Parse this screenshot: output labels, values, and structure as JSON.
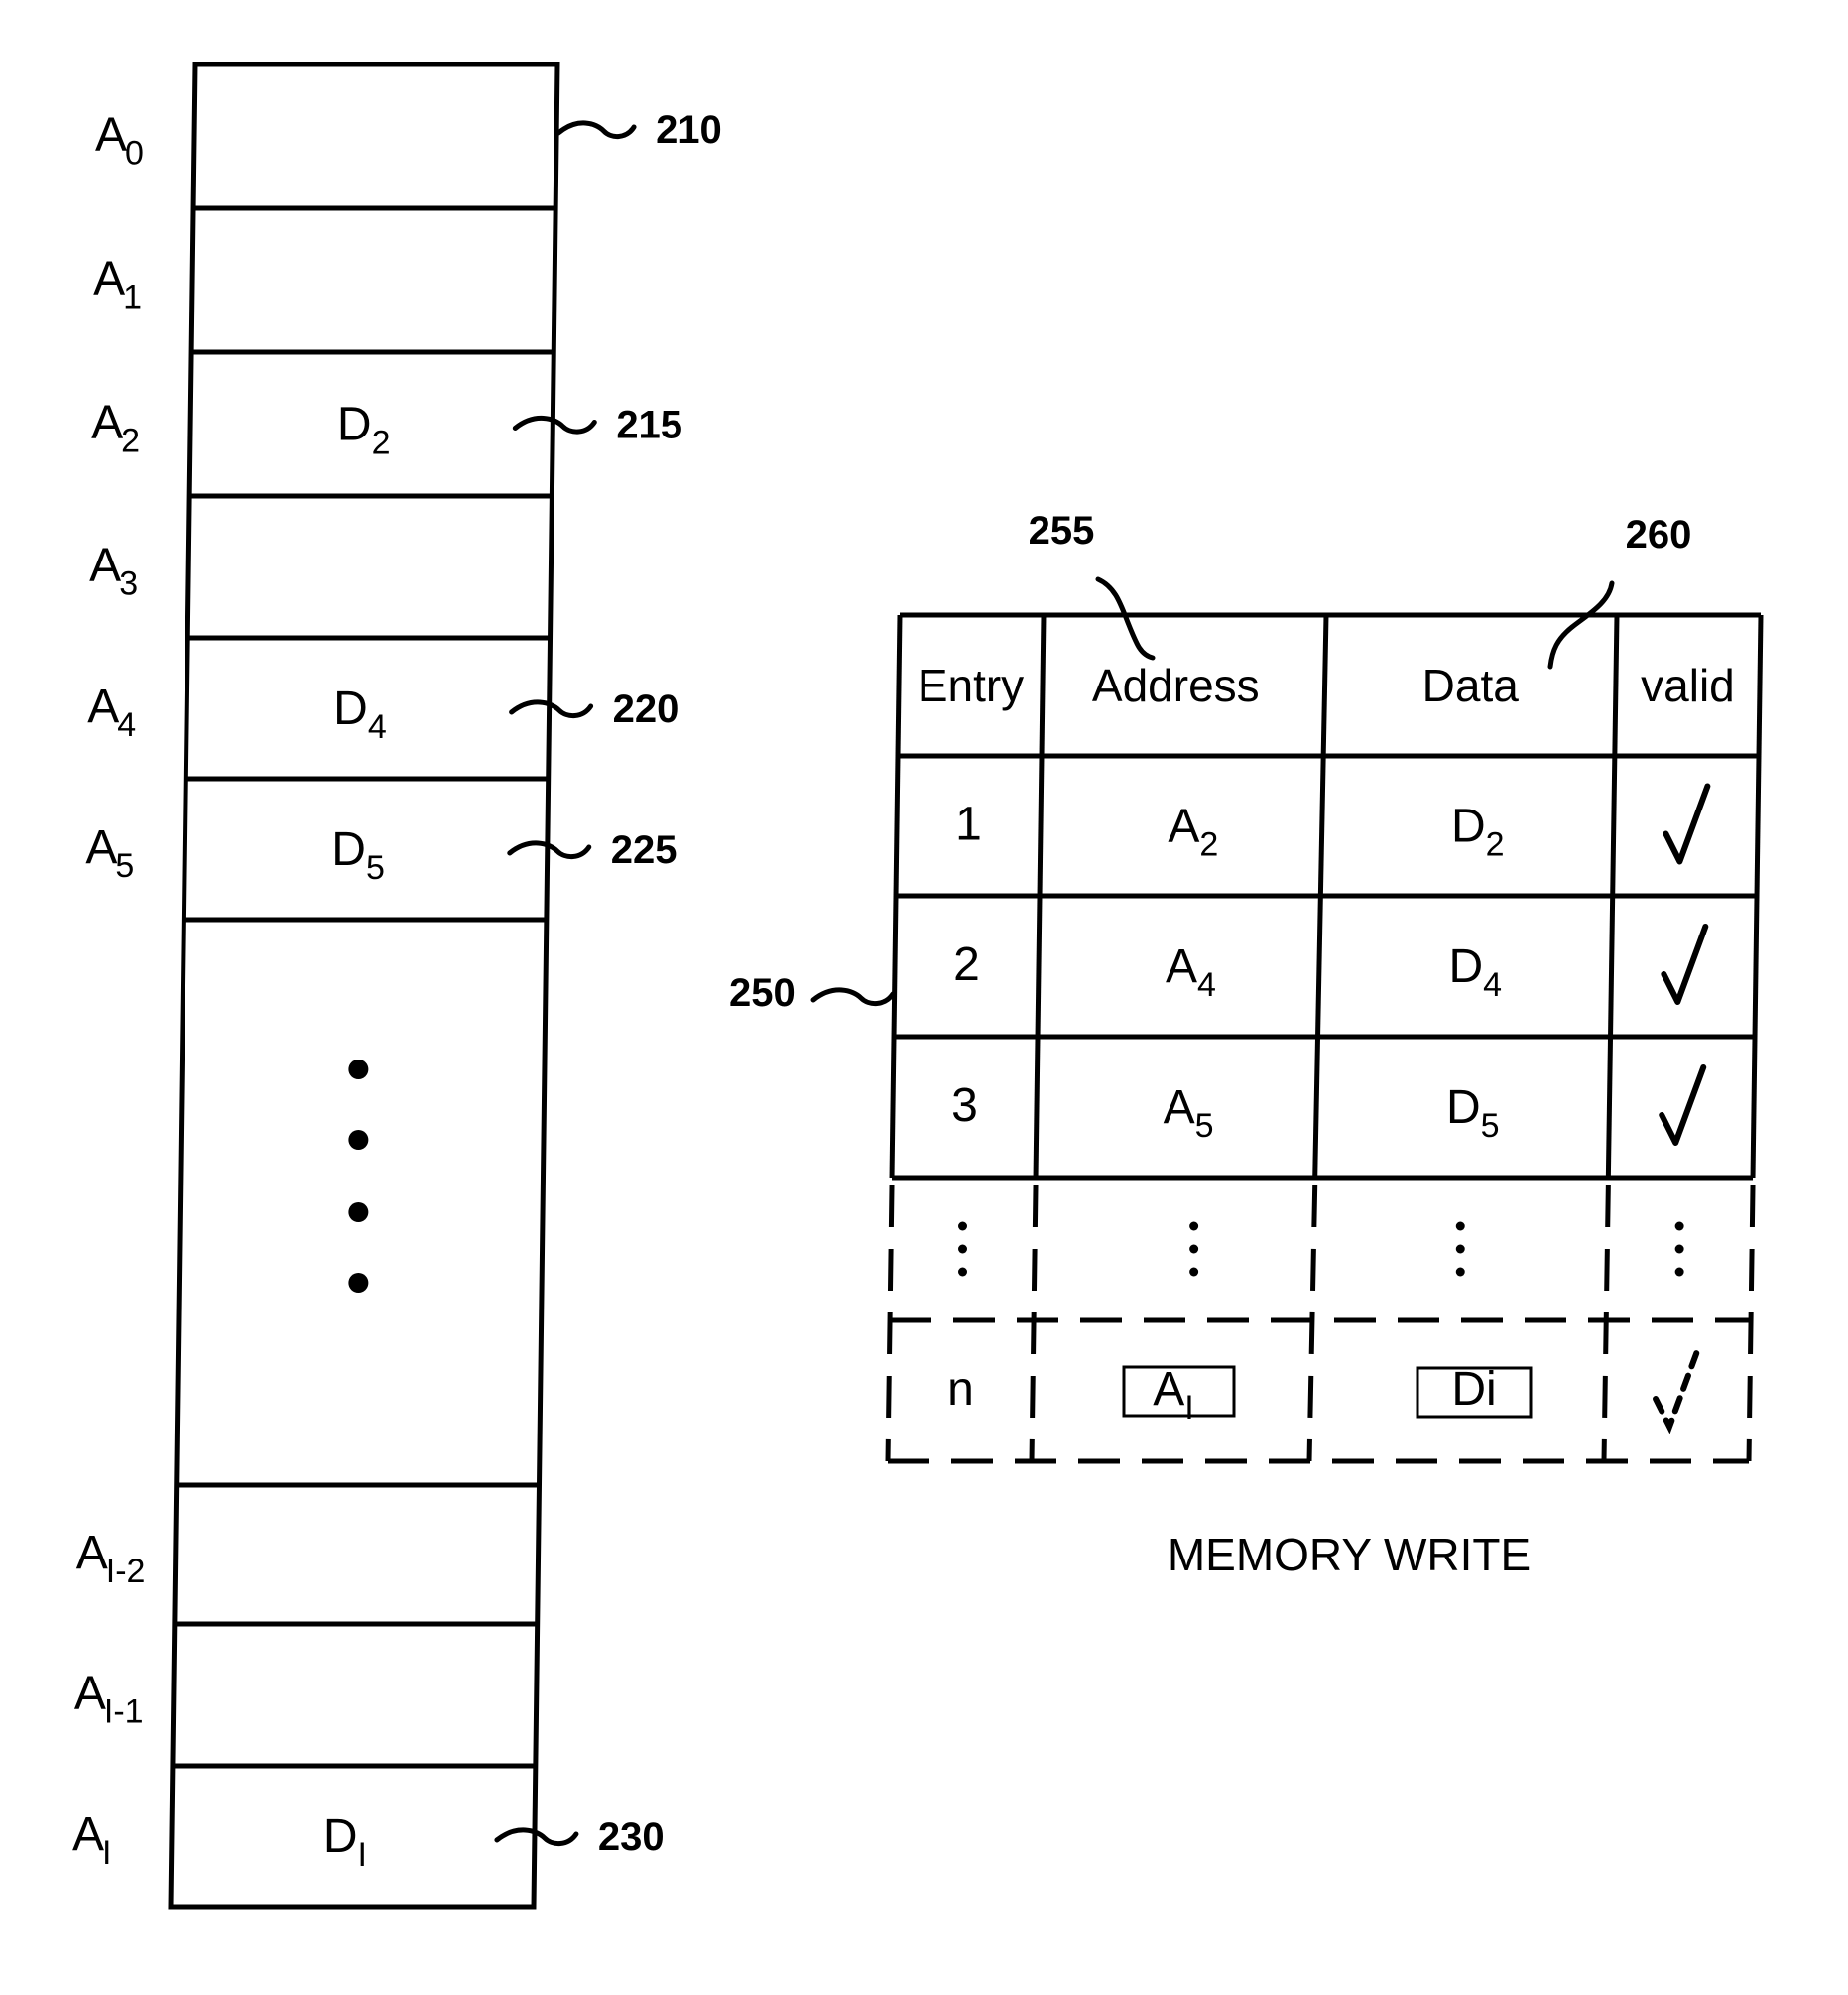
{
  "memory": {
    "rows": [
      {
        "address": "A",
        "address_sub": "0",
        "data": "",
        "data_sub": "",
        "ref": "210"
      },
      {
        "address": "A",
        "address_sub": "1",
        "data": "",
        "data_sub": "",
        "ref": ""
      },
      {
        "address": "A",
        "address_sub": "2",
        "data": "D",
        "data_sub": "2",
        "ref": "215"
      },
      {
        "address": "A",
        "address_sub": "3",
        "data": "",
        "data_sub": "",
        "ref": ""
      },
      {
        "address": "A",
        "address_sub": "4",
        "data": "D",
        "data_sub": "4",
        "ref": "220"
      },
      {
        "address": "A",
        "address_sub": "5",
        "data": "D",
        "data_sub": "5",
        "ref": "225"
      },
      {
        "ellipsis": true
      },
      {
        "address": "A",
        "address_sub": "I-2",
        "data": "",
        "data_sub": "",
        "ref": ""
      },
      {
        "address": "A",
        "address_sub": "I-1",
        "data": "",
        "data_sub": "",
        "ref": ""
      },
      {
        "address": "A",
        "address_sub": "I",
        "data": "D",
        "data_sub": "I",
        "ref": "230"
      }
    ]
  },
  "table": {
    "ref": "250",
    "header_refs": {
      "address": "255",
      "data": "260"
    },
    "headers": [
      "Entry",
      "Address",
      "Data",
      "valid"
    ],
    "rows": [
      {
        "entry": "1",
        "address": "A",
        "address_sub": "2",
        "data": "D",
        "data_sub": "2",
        "valid": true
      },
      {
        "entry": "2",
        "address": "A",
        "address_sub": "4",
        "data": "D",
        "data_sub": "4",
        "valid": true
      },
      {
        "entry": "3",
        "address": "A",
        "address_sub": "5",
        "data": "D",
        "data_sub": "5",
        "valid": true
      }
    ],
    "pending_row": {
      "entry": "n",
      "address": "A",
      "address_sub": "I",
      "data": "Di",
      "valid": true
    },
    "caption": "MEMORY WRITE"
  }
}
